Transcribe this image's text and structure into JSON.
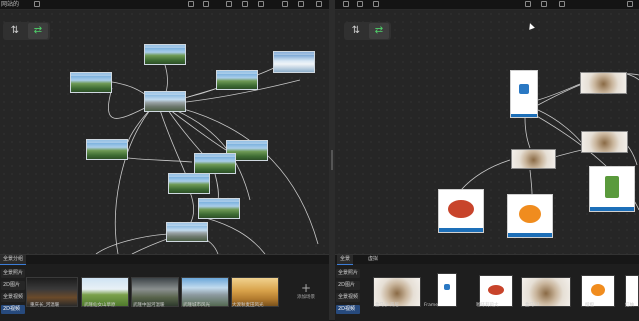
{
  "app": {
    "logo_text": "网站的"
  },
  "left_toolbar": {
    "icons": [
      "grid-icon",
      "save-icon",
      "image-icon",
      "crop-icon",
      "layers-icon",
      "info-icon",
      "cloud-icon",
      "upload-icon",
      "settings-icon"
    ]
  },
  "right_toolbar": {
    "icons": [
      "grid-icon",
      "save-icon",
      "layers-icon",
      "image-icon",
      "save-alt-icon",
      "settings-icon"
    ]
  },
  "left_canvas": {
    "mode_buttons": [
      {
        "glyph": "⇅",
        "active": false
      },
      {
        "glyph": "⇄",
        "active": true
      }
    ]
  },
  "right_canvas": {
    "mode_buttons": [
      {
        "glyph": "⇅",
        "active": false
      },
      {
        "glyph": "⇄",
        "active": true
      }
    ]
  },
  "left_panel": {
    "tab": "全景分组",
    "categories": [
      "全景照片",
      "2D图片",
      "全景视频",
      "2D视频"
    ],
    "active_category": 3,
    "thumbs": [
      {
        "label": "重庆长_河温暖"
      },
      {
        "label": "武隆仙女山草原"
      },
      {
        "label": "武隆中国河温暖"
      },
      {
        "label": "武隆城市风光"
      },
      {
        "label": "大渡秋麦田风光"
      }
    ],
    "add_label": "添加场景",
    "add_glyph": "+"
  },
  "right_panel": {
    "tabs": [
      "全景",
      "虚拟"
    ],
    "categories": [
      "全景照片",
      "2D图片",
      "全景视频",
      "2D视频"
    ],
    "active_category": 3,
    "thumbs": [
      {
        "label": "盒马小 海尼"
      },
      {
        "label": "Frame"
      },
      {
        "label": "咖啡莉莉大"
      },
      {
        "label": "盒马21"
      },
      {
        "label": "橙橙"
      },
      {
        "label": "红柚"
      }
    ]
  }
}
